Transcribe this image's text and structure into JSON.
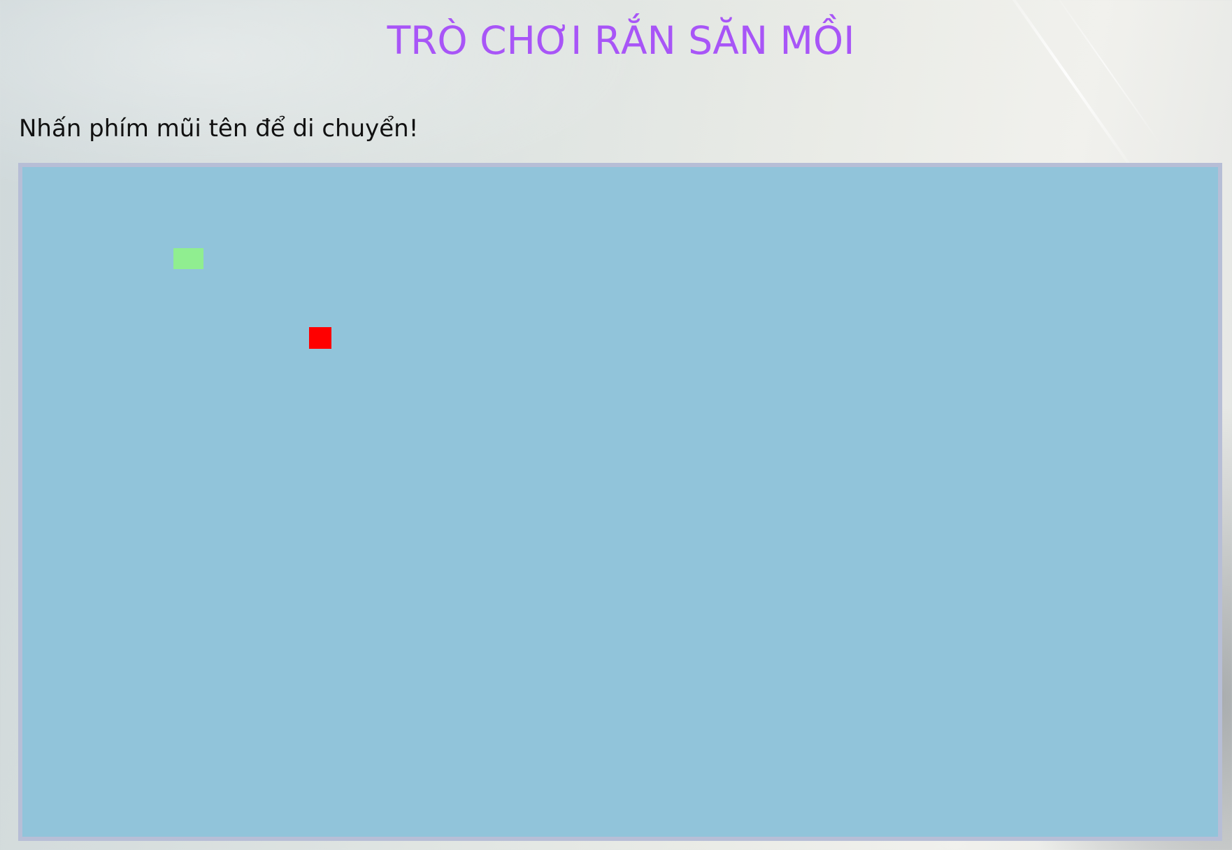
{
  "page": {
    "title": "TRÒ CHƠI RẮN SĂN MỒI",
    "instructions": "Nhấn phím mũi tên để di chuyển!"
  },
  "colors": {
    "title": "#a855f7",
    "board_background": "#91c4da",
    "board_border": "#b7bed6",
    "snake": "#90ee90",
    "food": "#ff0000"
  },
  "game": {
    "snake_segments": 1,
    "food_items": 1
  }
}
